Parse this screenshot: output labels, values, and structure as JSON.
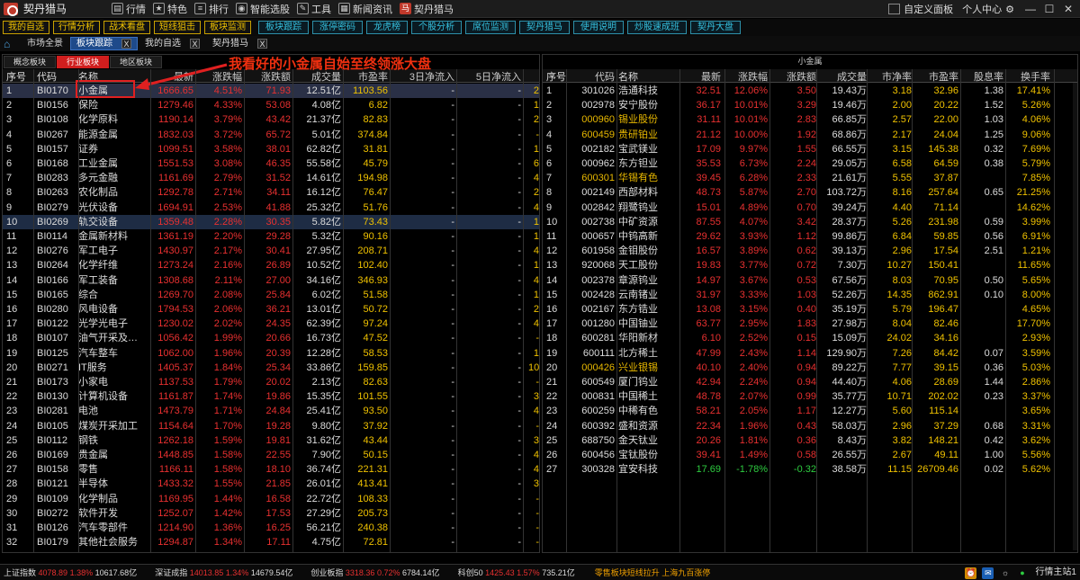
{
  "app": {
    "title": "契丹猎马"
  },
  "menu": [
    {
      "label": "行情",
      "icon": "chart-icon"
    },
    {
      "label": "特色",
      "icon": "star-icon"
    },
    {
      "label": "排行",
      "icon": "ranking-icon"
    },
    {
      "label": "智能选股",
      "icon": "filter-icon"
    },
    {
      "label": "工具",
      "icon": "tools-icon"
    },
    {
      "label": "新闻资讯",
      "icon": "news-icon"
    },
    {
      "label": "契丹猎马",
      "icon": "brand-icon"
    }
  ],
  "top_right": {
    "custom_panel": "自定义面板",
    "personal_center": "个人中心"
  },
  "buttons": {
    "yellow": [
      "我的自选",
      "行情分析",
      "战术看盘",
      "短线狙击",
      "板块监测"
    ],
    "cyan": [
      "板块跟踪",
      "涨停密码",
      "龙虎榜",
      "个股分析",
      "席位监测",
      "契丹猎马",
      "使用说明",
      "炒股速成班",
      "契丹大盘"
    ]
  },
  "tabs": [
    {
      "label": "市场全景",
      "active": false,
      "closable": false
    },
    {
      "label": "板块跟踪",
      "active": true,
      "closable": true
    },
    {
      "label": "我的自选",
      "active": false,
      "closable": true
    },
    {
      "label": "契丹猎马",
      "active": false,
      "closable": true
    }
  ],
  "left": {
    "subtabs": [
      "概念板块",
      "行业板块",
      "地区板块"
    ],
    "active_subtab": 1,
    "headers": {
      "seq": "序号",
      "code": "代码",
      "name": "名称",
      "latest": "最新",
      "pct": "涨跌幅",
      "chg": "涨跌额",
      "vol": "成交量",
      "pe": "市盈率",
      "f3": "3日净流入",
      "f5": "5日净流入"
    },
    "rows": [
      {
        "seq": "1",
        "code": "BI0170",
        "name": "小金属",
        "latest": "1666.65",
        "pct": "4.51%",
        "chg": "71.93",
        "vol": "12.51亿",
        "pe": "1103.56",
        "f3": "-",
        "f5": "-",
        "ex": "2"
      },
      {
        "seq": "2",
        "code": "BI0156",
        "name": "保险",
        "latest": "1279.46",
        "pct": "4.33%",
        "chg": "53.08",
        "vol": "4.08亿",
        "pe": "6.82",
        "f3": "-",
        "f5": "-",
        "ex": "1"
      },
      {
        "seq": "3",
        "code": "BI0108",
        "name": "化学原料",
        "latest": "1190.14",
        "pct": "3.79%",
        "chg": "43.42",
        "vol": "21.37亿",
        "pe": "82.83",
        "f3": "-",
        "f5": "-",
        "ex": "2"
      },
      {
        "seq": "4",
        "code": "BI0267",
        "name": "能源金属",
        "latest": "1832.03",
        "pct": "3.72%",
        "chg": "65.72",
        "vol": "5.01亿",
        "pe": "374.84",
        "f3": "-",
        "f5": "-",
        "ex": "-"
      },
      {
        "seq": "5",
        "code": "BI0157",
        "name": "证券",
        "latest": "1099.51",
        "pct": "3.58%",
        "chg": "38.01",
        "vol": "62.82亿",
        "pe": "31.81",
        "f3": "-",
        "f5": "-",
        "ex": "1"
      },
      {
        "seq": "6",
        "code": "BI0168",
        "name": "工业金属",
        "latest": "1551.53",
        "pct": "3.08%",
        "chg": "46.35",
        "vol": "55.58亿",
        "pe": "45.79",
        "f3": "-",
        "f5": "-",
        "ex": "6"
      },
      {
        "seq": "7",
        "code": "BI0283",
        "name": "多元金融",
        "latest": "1161.69",
        "pct": "2.79%",
        "chg": "31.52",
        "vol": "14.61亿",
        "pe": "194.98",
        "f3": "-",
        "f5": "-",
        "ex": "4"
      },
      {
        "seq": "8",
        "code": "BI0263",
        "name": "农化制品",
        "latest": "1292.78",
        "pct": "2.71%",
        "chg": "34.11",
        "vol": "16.12亿",
        "pe": "76.47",
        "f3": "-",
        "f5": "-",
        "ex": "2"
      },
      {
        "seq": "9",
        "code": "BI0279",
        "name": "光伏设备",
        "latest": "1694.91",
        "pct": "2.53%",
        "chg": "41.88",
        "vol": "25.32亿",
        "pe": "51.76",
        "f3": "-",
        "f5": "-",
        "ex": "4"
      },
      {
        "seq": "10",
        "code": "BI0269",
        "name": "轨交设备",
        "latest": "1359.48",
        "pct": "2.28%",
        "chg": "30.35",
        "vol": "5.82亿",
        "pe": "73.43",
        "f3": "-",
        "f5": "-",
        "ex": "1"
      },
      {
        "seq": "11",
        "code": "BI0114",
        "name": "金属新材料",
        "latest": "1361.19",
        "pct": "2.20%",
        "chg": "29.28",
        "vol": "5.32亿",
        "pe": "90.16",
        "f3": "-",
        "f5": "-",
        "ex": "1"
      },
      {
        "seq": "12",
        "code": "BI0276",
        "name": "军工电子",
        "latest": "1430.97",
        "pct": "2.17%",
        "chg": "30.41",
        "vol": "27.95亿",
        "pe": "208.71",
        "f3": "-",
        "f5": "-",
        "ex": "4"
      },
      {
        "seq": "13",
        "code": "BI0264",
        "name": "化学纤维",
        "latest": "1273.24",
        "pct": "2.16%",
        "chg": "26.89",
        "vol": "10.52亿",
        "pe": "102.40",
        "f3": "-",
        "f5": "-",
        "ex": "1"
      },
      {
        "seq": "14",
        "code": "BI0166",
        "name": "军工装备",
        "latest": "1308.68",
        "pct": "2.11%",
        "chg": "27.00",
        "vol": "34.16亿",
        "pe": "346.93",
        "f3": "-",
        "f5": "-",
        "ex": "4"
      },
      {
        "seq": "15",
        "code": "BI0165",
        "name": "综合",
        "latest": "1269.70",
        "pct": "2.08%",
        "chg": "25.84",
        "vol": "6.02亿",
        "pe": "51.58",
        "f3": "-",
        "f5": "-",
        "ex": "1"
      },
      {
        "seq": "16",
        "code": "BI0280",
        "name": "风电设备",
        "latest": "1794.53",
        "pct": "2.06%",
        "chg": "36.21",
        "vol": "13.01亿",
        "pe": "50.72",
        "f3": "-",
        "f5": "-",
        "ex": "2"
      },
      {
        "seq": "17",
        "code": "BI0122",
        "name": "光学光电子",
        "latest": "1230.02",
        "pct": "2.02%",
        "chg": "24.35",
        "vol": "62.39亿",
        "pe": "97.24",
        "f3": "-",
        "f5": "-",
        "ex": "4"
      },
      {
        "seq": "18",
        "code": "BI0107",
        "name": "油气开采及…",
        "latest": "1056.42",
        "pct": "1.99%",
        "chg": "20.66",
        "vol": "16.73亿",
        "pe": "47.52",
        "f3": "-",
        "f5": "-",
        "ex": "-"
      },
      {
        "seq": "19",
        "code": "BI0125",
        "name": "汽车整车",
        "latest": "1062.00",
        "pct": "1.96%",
        "chg": "20.39",
        "vol": "12.28亿",
        "pe": "58.53",
        "f3": "-",
        "f5": "-",
        "ex": "1"
      },
      {
        "seq": "20",
        "code": "BI0271",
        "name": "IT服务",
        "latest": "1405.37",
        "pct": "1.84%",
        "chg": "25.34",
        "vol": "33.86亿",
        "pe": "159.85",
        "f3": "-",
        "f5": "-",
        "ex": "10"
      },
      {
        "seq": "21",
        "code": "BI0173",
        "name": "小家电",
        "latest": "1137.53",
        "pct": "1.79%",
        "chg": "20.02",
        "vol": "2.13亿",
        "pe": "82.63",
        "f3": "-",
        "f5": "-",
        "ex": "-"
      },
      {
        "seq": "22",
        "code": "BI0130",
        "name": "计算机设备",
        "latest": "1161.87",
        "pct": "1.74%",
        "chg": "19.86",
        "vol": "15.35亿",
        "pe": "101.55",
        "f3": "-",
        "f5": "-",
        "ex": "3"
      },
      {
        "seq": "23",
        "code": "BI0281",
        "name": "电池",
        "latest": "1473.79",
        "pct": "1.71%",
        "chg": "24.84",
        "vol": "25.41亿",
        "pe": "93.50",
        "f3": "-",
        "f5": "-",
        "ex": "4"
      },
      {
        "seq": "24",
        "code": "BI0105",
        "name": "煤炭开采加工",
        "latest": "1154.64",
        "pct": "1.70%",
        "chg": "19.28",
        "vol": "9.80亿",
        "pe": "37.92",
        "f3": "-",
        "f5": "-",
        "ex": "-"
      },
      {
        "seq": "25",
        "code": "BI0112",
        "name": "钢铁",
        "latest": "1262.18",
        "pct": "1.59%",
        "chg": "19.81",
        "vol": "31.62亿",
        "pe": "43.44",
        "f3": "-",
        "f5": "-",
        "ex": "3"
      },
      {
        "seq": "26",
        "code": "BI0169",
        "name": "贵金属",
        "latest": "1448.85",
        "pct": "1.58%",
        "chg": "22.55",
        "vol": "7.90亿",
        "pe": "50.15",
        "f3": "-",
        "f5": "-",
        "ex": "4"
      },
      {
        "seq": "27",
        "code": "BI0158",
        "name": "零售",
        "latest": "1166.11",
        "pct": "1.58%",
        "chg": "18.10",
        "vol": "36.74亿",
        "pe": "221.31",
        "f3": "-",
        "f5": "-",
        "ex": "4"
      },
      {
        "seq": "28",
        "code": "BI0121",
        "name": "半导体",
        "latest": "1433.32",
        "pct": "1.55%",
        "chg": "21.85",
        "vol": "26.01亿",
        "pe": "413.41",
        "f3": "-",
        "f5": "-",
        "ex": "3"
      },
      {
        "seq": "29",
        "code": "BI0109",
        "name": "化学制品",
        "latest": "1169.95",
        "pct": "1.44%",
        "chg": "16.58",
        "vol": "22.72亿",
        "pe": "108.33",
        "f3": "-",
        "f5": "-",
        "ex": "-"
      },
      {
        "seq": "30",
        "code": "BI0272",
        "name": "软件开发",
        "latest": "1252.07",
        "pct": "1.42%",
        "chg": "17.53",
        "vol": "27.29亿",
        "pe": "205.73",
        "f3": "-",
        "f5": "-",
        "ex": "-"
      },
      {
        "seq": "31",
        "code": "BI0126",
        "name": "汽车零部件",
        "latest": "1214.90",
        "pct": "1.36%",
        "chg": "16.25",
        "vol": "56.21亿",
        "pe": "240.38",
        "f3": "-",
        "f5": "-",
        "ex": "-"
      },
      {
        "seq": "32",
        "code": "BI0179",
        "name": "其他社会服务",
        "latest": "1294.87",
        "pct": "1.34%",
        "chg": "17.11",
        "vol": "4.75亿",
        "pe": "72.81",
        "f3": "-",
        "f5": "-",
        "ex": "-"
      }
    ]
  },
  "annotation": {
    "text": "我看好的小金属自始至终领涨大盘"
  },
  "right": {
    "title": "小金属",
    "headers": {
      "seq": "序号",
      "code": "代码",
      "name": "名称",
      "latest": "最新",
      "pct": "涨跌幅",
      "chg": "涨跌额",
      "vol": "成交量",
      "pb": "市净率",
      "pe": "市盈率",
      "div": "股息率",
      "to": "换手率"
    },
    "rows": [
      {
        "seq": "1",
        "code": "301026",
        "name": "浩通科技",
        "latest": "32.51",
        "pct": "12.06%",
        "chg": "3.50",
        "vol": "19.43万",
        "pb": "3.18",
        "pe": "32.96",
        "div": "1.38",
        "to": "17.41%"
      },
      {
        "seq": "2",
        "code": "002978",
        "name": "安宁股份",
        "latest": "36.17",
        "pct": "10.01%",
        "chg": "3.29",
        "vol": "19.46万",
        "pb": "2.00",
        "pe": "20.22",
        "div": "1.52",
        "to": "5.26%"
      },
      {
        "seq": "3",
        "code": "000960",
        "name": "锡业股份",
        "latest": "31.11",
        "pct": "10.01%",
        "chg": "2.83",
        "vol": "66.85万",
        "pb": "2.57",
        "pe": "22.00",
        "div": "1.03",
        "to": "4.06%",
        "yellow": true
      },
      {
        "seq": "4",
        "code": "600459",
        "name": "贵研铂业",
        "latest": "21.12",
        "pct": "10.00%",
        "chg": "1.92",
        "vol": "68.86万",
        "pb": "2.17",
        "pe": "24.04",
        "div": "1.25",
        "to": "9.06%",
        "yellow": true
      },
      {
        "seq": "5",
        "code": "002182",
        "name": "宝武镁业",
        "latest": "17.09",
        "pct": "9.97%",
        "chg": "1.55",
        "vol": "66.55万",
        "pb": "3.15",
        "pe": "145.38",
        "div": "0.32",
        "to": "7.69%"
      },
      {
        "seq": "6",
        "code": "000962",
        "name": "东方钽业",
        "latest": "35.53",
        "pct": "6.73%",
        "chg": "2.24",
        "vol": "29.05万",
        "pb": "6.58",
        "pe": "64.59",
        "div": "0.38",
        "to": "5.79%"
      },
      {
        "seq": "7",
        "code": "600301",
        "name": "华锡有色",
        "latest": "39.45",
        "pct": "6.28%",
        "chg": "2.33",
        "vol": "21.61万",
        "pb": "5.55",
        "pe": "37.87",
        "div": "",
        "to": "7.85%",
        "yellow": true
      },
      {
        "seq": "8",
        "code": "002149",
        "name": "西部材料",
        "latest": "48.73",
        "pct": "5.87%",
        "chg": "2.70",
        "vol": "103.72万",
        "pb": "8.16",
        "pe": "257.64",
        "div": "0.65",
        "to": "21.25%"
      },
      {
        "seq": "9",
        "code": "002842",
        "name": "翔鹭钨业",
        "latest": "15.01",
        "pct": "4.89%",
        "chg": "0.70",
        "vol": "39.24万",
        "pb": "4.40",
        "pe": "71.14",
        "div": "",
        "to": "14.62%"
      },
      {
        "seq": "10",
        "code": "002738",
        "name": "中矿资源",
        "latest": "87.55",
        "pct": "4.07%",
        "chg": "3.42",
        "vol": "28.37万",
        "pb": "5.26",
        "pe": "231.98",
        "div": "0.59",
        "to": "3.99%"
      },
      {
        "seq": "11",
        "code": "000657",
        "name": "中钨高新",
        "latest": "29.62",
        "pct": "3.93%",
        "chg": "1.12",
        "vol": "99.86万",
        "pb": "6.84",
        "pe": "59.85",
        "div": "0.56",
        "to": "6.91%"
      },
      {
        "seq": "12",
        "code": "601958",
        "name": "金钼股份",
        "latest": "16.57",
        "pct": "3.89%",
        "chg": "0.62",
        "vol": "39.13万",
        "pb": "2.96",
        "pe": "17.54",
        "div": "2.51",
        "to": "1.21%"
      },
      {
        "seq": "13",
        "code": "920068",
        "name": "天工股份",
        "latest": "19.83",
        "pct": "3.77%",
        "chg": "0.72",
        "vol": "7.30万",
        "pb": "10.27",
        "pe": "150.41",
        "div": "",
        "to": "11.65%"
      },
      {
        "seq": "14",
        "code": "002378",
        "name": "章源钨业",
        "latest": "14.97",
        "pct": "3.67%",
        "chg": "0.53",
        "vol": "67.56万",
        "pb": "8.03",
        "pe": "70.95",
        "div": "0.50",
        "to": "5.65%"
      },
      {
        "seq": "15",
        "code": "002428",
        "name": "云南锗业",
        "latest": "31.97",
        "pct": "3.33%",
        "chg": "1.03",
        "vol": "52.26万",
        "pb": "14.35",
        "pe": "862.91",
        "div": "0.10",
        "to": "8.00%"
      },
      {
        "seq": "16",
        "code": "002167",
        "name": "东方锆业",
        "latest": "13.08",
        "pct": "3.15%",
        "chg": "0.40",
        "vol": "35.19万",
        "pb": "5.79",
        "pe": "196.47",
        "div": "",
        "to": "4.65%"
      },
      {
        "seq": "17",
        "code": "001280",
        "name": "中国铀业",
        "latest": "63.77",
        "pct": "2.95%",
        "chg": "1.83",
        "vol": "27.98万",
        "pb": "8.04",
        "pe": "82.46",
        "div": "",
        "to": "17.70%"
      },
      {
        "seq": "18",
        "code": "600281",
        "name": "华阳新材",
        "latest": "6.10",
        "pct": "2.52%",
        "chg": "0.15",
        "vol": "15.09万",
        "pb": "24.02",
        "pe": "34.16",
        "div": "",
        "to": "2.93%"
      },
      {
        "seq": "19",
        "code": "600111",
        "name": "北方稀土",
        "latest": "47.99",
        "pct": "2.43%",
        "chg": "1.14",
        "vol": "129.90万",
        "pb": "7.26",
        "pe": "84.42",
        "div": "0.07",
        "to": "3.59%"
      },
      {
        "seq": "20",
        "code": "000426",
        "name": "兴业银锡",
        "latest": "40.10",
        "pct": "2.40%",
        "chg": "0.94",
        "vol": "89.22万",
        "pb": "7.77",
        "pe": "39.15",
        "div": "0.36",
        "to": "5.03%",
        "yellow": true
      },
      {
        "seq": "21",
        "code": "600549",
        "name": "厦门钨业",
        "latest": "42.94",
        "pct": "2.24%",
        "chg": "0.94",
        "vol": "44.40万",
        "pb": "4.06",
        "pe": "28.69",
        "div": "1.44",
        "to": "2.86%"
      },
      {
        "seq": "22",
        "code": "000831",
        "name": "中国稀土",
        "latest": "48.78",
        "pct": "2.07%",
        "chg": "0.99",
        "vol": "35.77万",
        "pb": "10.71",
        "pe": "202.02",
        "div": "0.23",
        "to": "3.37%"
      },
      {
        "seq": "23",
        "code": "600259",
        "name": "中稀有色",
        "latest": "58.21",
        "pct": "2.05%",
        "chg": "1.17",
        "vol": "12.27万",
        "pb": "5.60",
        "pe": "115.14",
        "div": "",
        "to": "3.65%"
      },
      {
        "seq": "24",
        "code": "600392",
        "name": "盛和资源",
        "latest": "22.34",
        "pct": "1.96%",
        "chg": "0.43",
        "vol": "58.03万",
        "pb": "2.96",
        "pe": "37.29",
        "div": "0.68",
        "to": "3.31%"
      },
      {
        "seq": "25",
        "code": "688750",
        "name": "金天钛业",
        "latest": "20.26",
        "pct": "1.81%",
        "chg": "0.36",
        "vol": "8.43万",
        "pb": "3.82",
        "pe": "148.21",
        "div": "0.42",
        "to": "3.62%"
      },
      {
        "seq": "26",
        "code": "600456",
        "name": "宝钛股份",
        "latest": "39.41",
        "pct": "1.49%",
        "chg": "0.58",
        "vol": "26.55万",
        "pb": "2.67",
        "pe": "49.11",
        "div": "1.00",
        "to": "5.56%"
      },
      {
        "seq": "27",
        "code": "300328",
        "name": "宜安科技",
        "latest": "17.69",
        "pct": "-1.78%",
        "chg": "-0.32",
        "vol": "38.58万",
        "pb": "11.15",
        "pe": "26709.46",
        "div": "0.02",
        "to": "5.62%",
        "down": true
      }
    ]
  },
  "status": {
    "indices": [
      {
        "name": "上证指数",
        "value": "4078.89",
        "pct": "1.38%",
        "amount": "10617.68亿"
      },
      {
        "name": "深证成指",
        "value": "14013.85",
        "pct": "1.34%",
        "amount": "14679.54亿"
      },
      {
        "name": "创业板指",
        "value": "3318.36",
        "pct": "0.72%",
        "amount": "6784.14亿"
      },
      {
        "name": "科创50",
        "value": "1425.43",
        "pct": "1.57%",
        "amount": "735.21亿"
      }
    ],
    "ticker": "零售板块短线拉升 上海九百涨停",
    "server": "行情主站1"
  },
  "colors": {
    "up": "#e83030",
    "down": "#2ecc40",
    "highlight": "#f0c200",
    "accent": "#d01e1e"
  }
}
